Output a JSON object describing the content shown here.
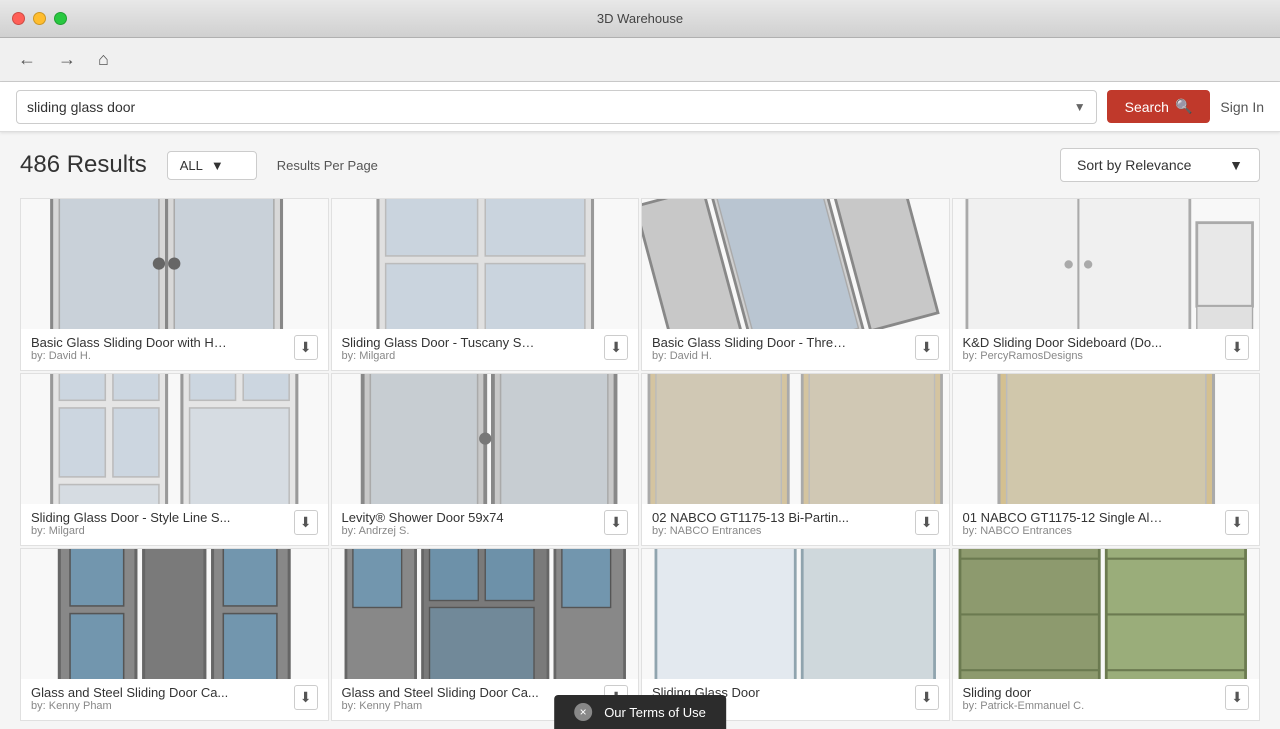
{
  "titlebar": {
    "title": "3D Warehouse"
  },
  "navbar": {
    "back_label": "←",
    "forward_label": "→",
    "home_label": "⌂"
  },
  "searchbar": {
    "query": "sliding glass door",
    "search_label": "Search",
    "signin_label": "Sign In",
    "dropdown_placeholder": "sliding glass door"
  },
  "results": {
    "count": "486 Results",
    "filter_label": "ALL",
    "per_page_label": "Results Per Page",
    "sort_label": "Sort by Relevance"
  },
  "items": [
    {
      "title": "Basic Glass Sliding Door with Ha...",
      "author": "by: David H.",
      "color": "#d0d0d0",
      "type": "double-door"
    },
    {
      "title": "Sliding Glass Door - Tuscany Ser...",
      "author": "by: Milgard",
      "color": "#c8c8c8",
      "type": "grid-door"
    },
    {
      "title": "Basic Glass Sliding Door - Three ...",
      "author": "by: David H.",
      "color": "#b0b0b0",
      "type": "triple-door"
    },
    {
      "title": "K&D Sliding Door Sideboard (Do...",
      "author": "by: PercyRamosDesigns",
      "color": "#e0e0e0",
      "type": "sideboard"
    },
    {
      "title": "Sliding Glass Door - Style Line S...",
      "author": "by: Milgard",
      "color": "#d5d5d5",
      "type": "grid-door-2"
    },
    {
      "title": "Levity® Shower Door 59x74",
      "author": "by: Andrzej S.",
      "color": "#c0c0c0",
      "type": "shower-door"
    },
    {
      "title": "02 NABCO GT1175-13 Bi-Partin...",
      "author": "by: NABCO Entrances",
      "color": "#c8b89a",
      "type": "bi-part"
    },
    {
      "title": "01 NABCO GT1175-12 Single All...",
      "author": "by: NABCO Entrances",
      "color": "#d0b890",
      "type": "single-auto"
    },
    {
      "title": "Glass and Steel Sliding Door Ca...",
      "author": "by: Kenny Pham",
      "color": "#888",
      "type": "steel-cabinet-1"
    },
    {
      "title": "Glass and Steel Sliding Door Ca...",
      "author": "by: Kenny Pham",
      "color": "#888",
      "type": "steel-cabinet-2"
    },
    {
      "title": "Sliding Glass Door",
      "author": "by:",
      "color": "#b0bec5",
      "type": "simple-sliding"
    },
    {
      "title": "Sliding door",
      "author": "by: Patrick-Emmanuel C.",
      "color": "#8d9a6e",
      "type": "barn-door"
    }
  ],
  "terms": {
    "label": "Our Terms of Use",
    "close_label": "×"
  }
}
